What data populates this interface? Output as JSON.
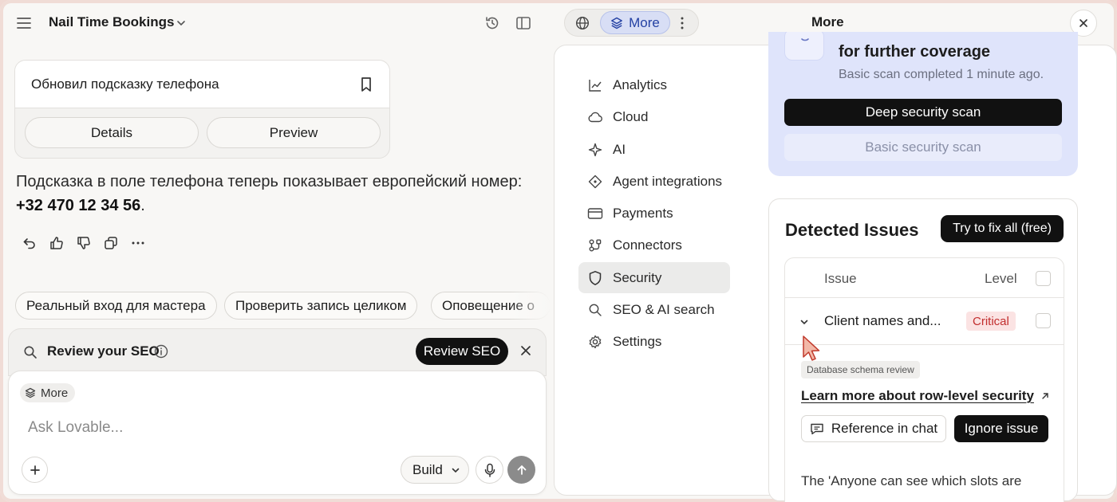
{
  "header": {
    "project_title": "Nail Time Bookings"
  },
  "chat": {
    "card_title": "Обновил подсказку телефона",
    "details_label": "Details",
    "preview_label": "Preview",
    "reply_text": "Подсказка в поле телефона теперь показывает европейский номер:",
    "reply_number": "+32 470 12 34 56",
    "reply_end": ".",
    "suggestions": [
      "Реальный вход для мастера",
      "Проверить запись целиком",
      "Оповещение о"
    ]
  },
  "composer": {
    "seo_label": "Review your SEO",
    "review_seo_button": "Review SEO",
    "more_chip": "More",
    "placeholder": "Ask Lovable...",
    "build_label": "Build"
  },
  "toolbar": {
    "more_tab": "More",
    "panel_title": "More"
  },
  "nav": {
    "items": [
      {
        "label": "Analytics",
        "icon": "chart-line-icon"
      },
      {
        "label": "Cloud",
        "icon": "cloud-icon"
      },
      {
        "label": "AI",
        "icon": "sparkle-icon"
      },
      {
        "label": "Agent integrations",
        "icon": "diamond-icon"
      },
      {
        "label": "Payments",
        "icon": "card-icon"
      },
      {
        "label": "Connectors",
        "icon": "connectors-icon"
      },
      {
        "label": "Security",
        "icon": "shield-icon",
        "active": true
      },
      {
        "label": "SEO & AI search",
        "icon": "search-icon"
      },
      {
        "label": "Settings",
        "icon": "gear-icon"
      }
    ]
  },
  "security": {
    "scan_heading": "for further coverage",
    "scan_status": "Basic scan completed 1 minute ago.",
    "deep_scan_button": "Deep security scan",
    "basic_scan_button": "Basic security scan",
    "issues_title": "Detected Issues",
    "fix_all_button": "Try to fix all (free)",
    "col_issue": "Issue",
    "col_level": "Level",
    "issue_name": "Client names and...",
    "issue_level": "Critical",
    "tag": "Database schema review",
    "learn_more": "Learn more about row-level security",
    "reference_button": "Reference in chat",
    "ignore_button": "Ignore issue",
    "description": "The 'Anyone can see which slots are"
  },
  "colors": {
    "accent_blue": "#2441a3",
    "scan_card_bg": "#dfe4fb",
    "critical_red": "#c22e2e"
  }
}
